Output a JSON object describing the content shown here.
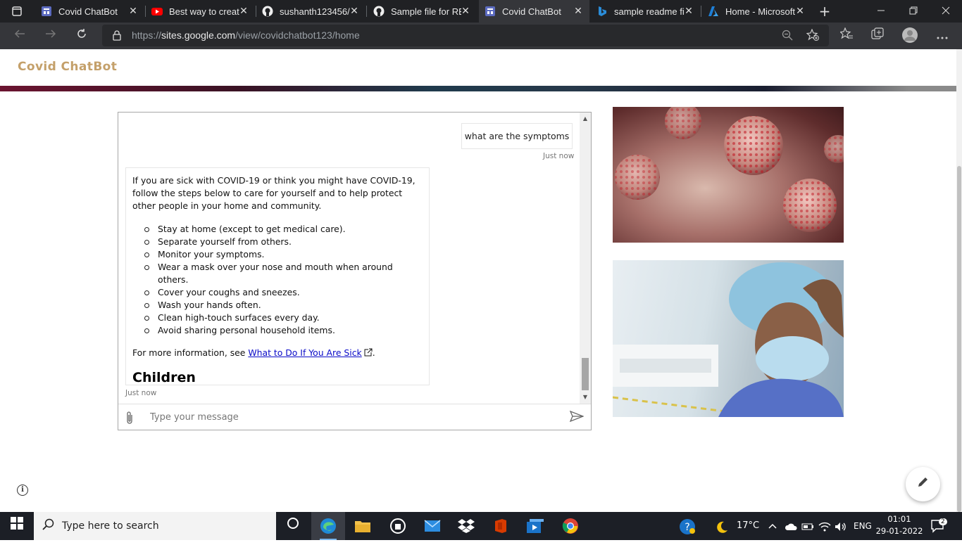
{
  "browser": {
    "tabs": [
      {
        "label": "Covid ChatBot",
        "icon": "sites-icon"
      },
      {
        "label": "Best way to creat",
        "icon": "youtube-icon"
      },
      {
        "label": "sushanth123456/",
        "icon": "github-icon"
      },
      {
        "label": "Sample file for RE",
        "icon": "github-icon"
      },
      {
        "label": "Covid ChatBot",
        "icon": "sites-icon",
        "active": true
      },
      {
        "label": "sample readme fi",
        "icon": "bing-icon"
      },
      {
        "label": "Home - Microsoft",
        "icon": "azure-icon"
      }
    ],
    "close_glyph": "✕",
    "new_tab_glyph": "+",
    "url_prefix": "https://",
    "url_host": "sites.google.com",
    "url_path": "/view/covidchatbot123/home"
  },
  "site": {
    "title": "Covid ChatBot",
    "title_color": "#c4a06a"
  },
  "chat": {
    "user_message": "what are the symptoms",
    "user_timestamp": "Just now",
    "bot_intro": "If you are sick with COVID-19 or think you might have COVID-19, follow the steps below to care for yourself and to help protect other people in your home and community.",
    "bot_items": [
      "Stay at home (except to get medical care).",
      "Separate yourself from others.",
      "Monitor your symptoms.",
      "Wear a mask over your nose and mouth when around others.",
      "Cover your coughs and sneezes.",
      "Wash your hands often.",
      "Clean high-touch surfaces every day.",
      "Avoid sharing personal household items."
    ],
    "more_info_prefix": "For more information, see ",
    "more_info_link": "What to Do If You Are Sick",
    "more_info_suffix": ".",
    "section_heading": "Children",
    "bot_timestamp": "Just now",
    "input_placeholder": "Type your message",
    "link_color": "#0a0ac8"
  },
  "taskbar": {
    "search_placeholder": "Type here to search",
    "temperature": "17°C",
    "language": "ENG",
    "time": "01:01",
    "date": "29-01-2022",
    "notification_count": "2"
  }
}
